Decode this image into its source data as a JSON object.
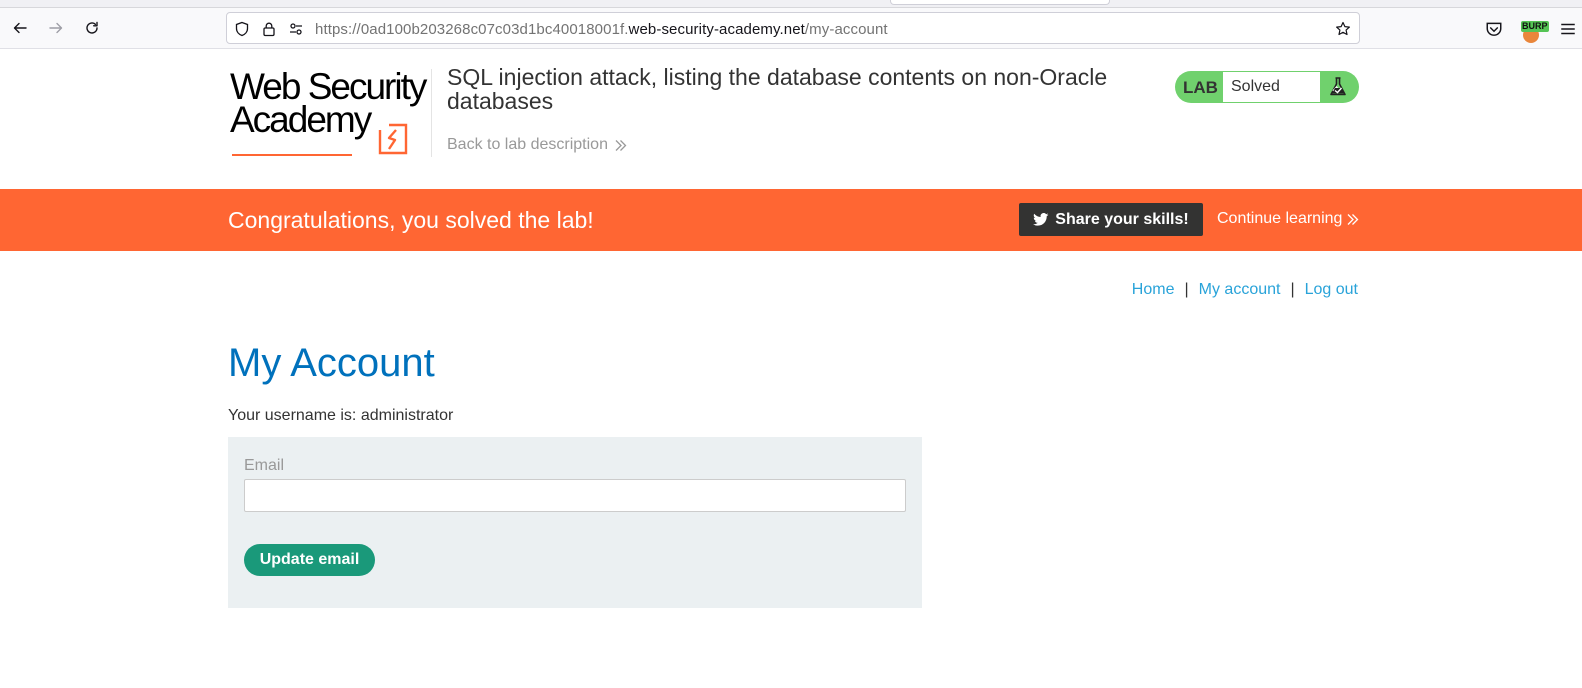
{
  "browser": {
    "url_prefix": "https://0ad100b203268c07c03d1bc40018001f.",
    "url_host": "web-security-academy.net",
    "url_path": "/my-account",
    "extension_badge": "BURP"
  },
  "lab_header": {
    "logo_line1": "Web Security",
    "logo_line2": "Academy",
    "title": "SQL injection attack, listing the database contents on non-Oracle databases",
    "back_link": "Back to lab description",
    "status_tag": "LAB",
    "status_value": "Solved"
  },
  "banner": {
    "message": "Congratulations, you solved the lab!",
    "share_label": "Share your skills!",
    "continue_label": "Continue learning"
  },
  "nav": {
    "home": "Home",
    "separator1": "|",
    "my_account": "My account",
    "separator2": "|",
    "log_out": "Log out"
  },
  "account": {
    "title": "My Account",
    "username_line": "Your username is: administrator",
    "email_label": "Email",
    "email_value": "",
    "update_button": "Update email"
  },
  "colors": {
    "banner": "#ff6633",
    "lab_solved": "#70d16d",
    "title_blue": "#0071bc",
    "link_blue": "#29a3d9",
    "update_button": "#1a997a",
    "form_bg": "#ebf0f2"
  }
}
